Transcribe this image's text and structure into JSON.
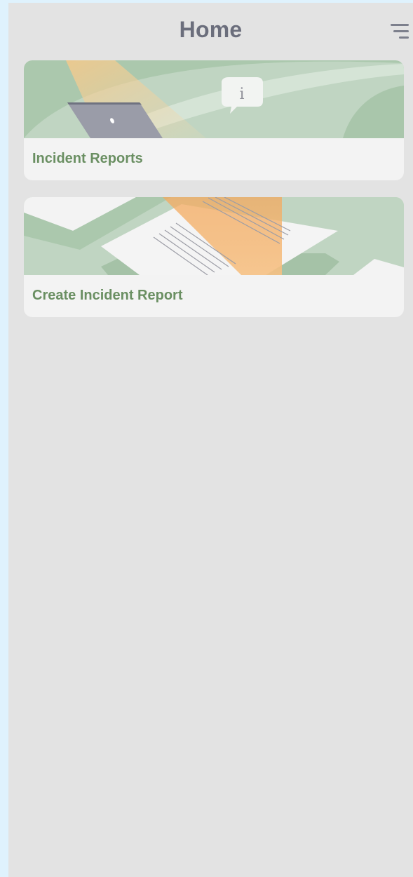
{
  "header": {
    "title": "Home",
    "menu_icon": "hamburger-menu-icon"
  },
  "cards": [
    {
      "label": "Incident Reports",
      "illustration": "laptop-info-illustration"
    },
    {
      "label": "Create Incident Report",
      "illustration": "document-illustration"
    }
  ],
  "colors": {
    "accent": "#6a8f62",
    "title": "#6b6e7c",
    "background": "#e3e3e3",
    "card": "#f3f3f3",
    "illustration_green": "#c0d5c2",
    "illustration_orange": "#f5b870"
  }
}
